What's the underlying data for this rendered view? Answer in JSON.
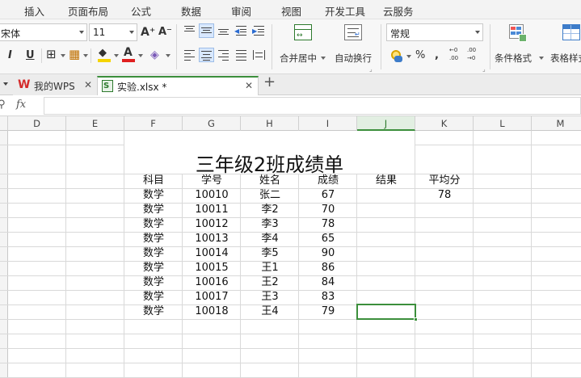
{
  "menu": [
    "插入",
    "页面布局",
    "公式",
    "数据",
    "审阅",
    "视图",
    "开发工具",
    "云服务"
  ],
  "ribbon": {
    "font_name": "宋体",
    "font_size": "11",
    "grow_font_icon": "A⁺",
    "shrink_font_icon": "A⁻",
    "merge_center_label": "合并居中",
    "wrap_text_label": "自动换行",
    "number_format": "常规",
    "percent_symbol": "%",
    "comma_symbol": "⁹",
    "increase_decimal": ".00\n+.0",
    "decrease_decimal": ".00\n-.0",
    "conditional_format_label": "条件格式",
    "table_style_label": "表格样式"
  },
  "tabs": [
    {
      "label": "我的WPS"
    },
    {
      "label": "实验.xlsx *"
    }
  ],
  "formula": {
    "fx_label": "fx",
    "value": ""
  },
  "columns": [
    "D",
    "E",
    "F",
    "G",
    "H",
    "I",
    "J",
    "K",
    "L",
    "M"
  ],
  "sheet": {
    "title": "三年级2班成绩单",
    "headers": [
      "科目",
      "学号",
      "姓名",
      "成绩",
      "结果",
      "平均分"
    ],
    "average": "78",
    "rows": [
      [
        "数学",
        "10010",
        "张二",
        "67"
      ],
      [
        "数学",
        "10011",
        "李2",
        "70"
      ],
      [
        "数学",
        "10012",
        "李3",
        "78"
      ],
      [
        "数学",
        "10013",
        "李4",
        "65"
      ],
      [
        "数学",
        "10014",
        "李5",
        "90"
      ],
      [
        "数学",
        "10015",
        "王1",
        "86"
      ],
      [
        "数学",
        "10016",
        "王2",
        "84"
      ],
      [
        "数学",
        "10017",
        "王3",
        "83"
      ],
      [
        "数学",
        "10018",
        "王4",
        "79"
      ]
    ]
  },
  "colors": {
    "accent_green": "#3c8f3c",
    "selected_col": "#e7f2e7",
    "wps_red": "#d42a2a"
  }
}
